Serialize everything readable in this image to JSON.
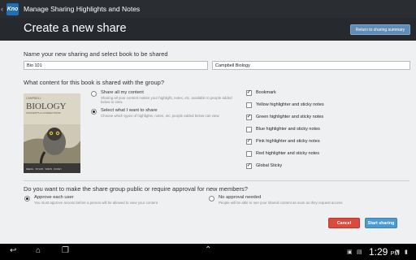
{
  "actionbar": {
    "title": "Manage Sharing Highlights and Notes",
    "logo_text": "Kno"
  },
  "header": {
    "title": "Create a new share",
    "return_button": "Return to sharing summary"
  },
  "name_section": {
    "label": "Name your new sharing and select book to be shared",
    "name_value": "Bio 101",
    "book_value": "Campbell Biology"
  },
  "content_section": {
    "label": "What content for this book is shared with the group?",
    "book_cover": {
      "brand": "CAMPBELL",
      "title": "BIOLOGY",
      "subtitle": "CONCEPTS & CONNECTIONS",
      "authors": "REECE · TAYLOR · SIMON · DICKEY"
    },
    "options": [
      {
        "title": "Share all my content",
        "desc": "Sharing all your content makes your highlight, notes, etc. available to people added below to view.",
        "selected": false
      },
      {
        "title": "Select what I want to share",
        "desc": "Choose which types of highlights, notes, etc. people added below can view.",
        "selected": true
      }
    ],
    "checklist": [
      {
        "label": "Bookmark",
        "checked": true,
        "mark": "✓"
      },
      {
        "label": "Yellow highlighter and sticky notes",
        "checked": false,
        "mark": ""
      },
      {
        "label": "Green highlighter and sticky notes",
        "checked": true,
        "mark": "✓"
      },
      {
        "label": "Blue highlighter and sticky notes",
        "checked": false,
        "mark": ""
      },
      {
        "label": "Pink highlighter and sticky notes",
        "checked": true,
        "mark": "✓"
      },
      {
        "label": "Red highlighter and sticky notes",
        "checked": false,
        "mark": ""
      },
      {
        "label": "Global Sticky",
        "checked": true,
        "mark": "✓"
      }
    ]
  },
  "approval_section": {
    "label": "Do you want to make the share group public or require approval for new members?",
    "options": [
      {
        "title": "Approve each user",
        "desc": "You must approve access before a person will be allowed to view your content",
        "selected": true
      },
      {
        "title": "No approval needed",
        "desc": "People will be able to see your shared content as soon as they request access",
        "selected": false
      }
    ]
  },
  "buttons": {
    "cancel": "Cancel",
    "start": "Start sharing"
  },
  "system_bar": {
    "time": "1:29",
    "ampm": "PM"
  },
  "colors": {
    "actionbar": "#2a2d31",
    "header": "#262a2f",
    "cancel": "#d94a3f",
    "start": "#4b9bd0",
    "return": "#5f8db8"
  }
}
